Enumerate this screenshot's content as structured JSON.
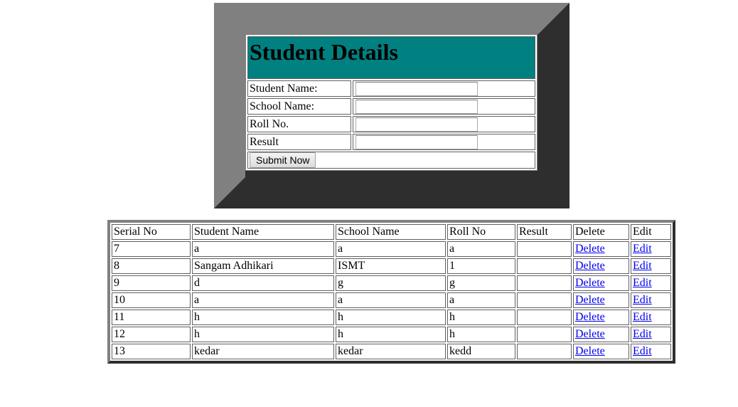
{
  "form": {
    "title": "Student Details",
    "fields": [
      {
        "label": "Student Name:",
        "value": ""
      },
      {
        "label": "School Name:",
        "value": ""
      },
      {
        "label": "Roll No.",
        "value": ""
      },
      {
        "label": "Result",
        "value": ""
      }
    ],
    "submit_label": "Submit Now"
  },
  "records": {
    "headers": [
      "Serial No",
      "Student Name",
      "School Name",
      "Roll No",
      "Result",
      "Delete",
      "Edit"
    ],
    "rows": [
      {
        "serial": "7",
        "student": "a",
        "school": "a",
        "roll": "a",
        "result": "",
        "delete": "Delete",
        "edit": "Edit"
      },
      {
        "serial": "8",
        "student": "Sangam Adhikari",
        "school": "ISMT",
        "roll": "1",
        "result": "",
        "delete": "Delete",
        "edit": "Edit"
      },
      {
        "serial": "9",
        "student": "d",
        "school": "g",
        "roll": "g",
        "result": "",
        "delete": "Delete",
        "edit": "Edit"
      },
      {
        "serial": "10",
        "student": "a",
        "school": "a",
        "roll": "a",
        "result": "",
        "delete": "Delete",
        "edit": "Edit"
      },
      {
        "serial": "11",
        "student": "h",
        "school": "h",
        "roll": "h",
        "result": "",
        "delete": "Delete",
        "edit": "Edit"
      },
      {
        "serial": "12",
        "student": "h",
        "school": "h",
        "roll": "h",
        "result": "",
        "delete": "Delete",
        "edit": "Edit"
      },
      {
        "serial": "13",
        "student": "kedar",
        "school": "kedar",
        "roll": "kedd",
        "result": "",
        "delete": "Delete",
        "edit": "Edit"
      }
    ]
  },
  "colors": {
    "header_bg": "#008080",
    "frame_light": "#808080",
    "frame_dark": "#2e2e2e",
    "link": "#0000ee"
  }
}
